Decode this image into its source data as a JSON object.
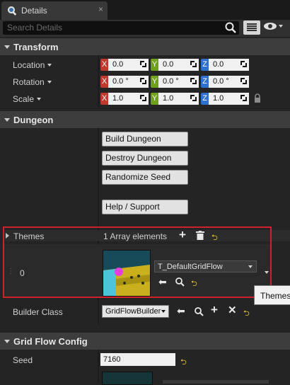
{
  "tab": {
    "title": "Details",
    "close": "×"
  },
  "search": {
    "placeholder": "Search Details"
  },
  "transform": {
    "title": "Transform",
    "location": {
      "label": "Location",
      "x": "0.0",
      "y": "0.0",
      "z": "0.0"
    },
    "rotation": {
      "label": "Rotation",
      "x": "0.0 °",
      "y": "0.0 °",
      "z": "0.0 °"
    },
    "scale": {
      "label": "Scale",
      "x": "1.0",
      "y": "1.0",
      "z": "1.0"
    },
    "axis": {
      "x": "X",
      "y": "Y",
      "z": "Z"
    }
  },
  "dungeon": {
    "title": "Dungeon",
    "buttons": [
      "Build Dungeon",
      "Destroy Dungeon",
      "Randomize Seed",
      "Help / Support"
    ],
    "themes": {
      "label": "Themes",
      "count": "1 Array elements",
      "index": "0",
      "asset": "T_DefaultGridFlow",
      "tooltip": "Themes"
    },
    "builder_class": {
      "label": "Builder Class",
      "value": "GridFlowBuilder"
    }
  },
  "grid_flow_config": {
    "title": "Grid Flow Config",
    "seed": {
      "label": "Seed",
      "value": "7160"
    }
  },
  "colors": {
    "highlight_border": "#d0202a",
    "axis_x": "#c0392b",
    "axis_y": "#6fa21a",
    "axis_z": "#2d6fd2",
    "reset_arrow": "#e8c42a"
  }
}
